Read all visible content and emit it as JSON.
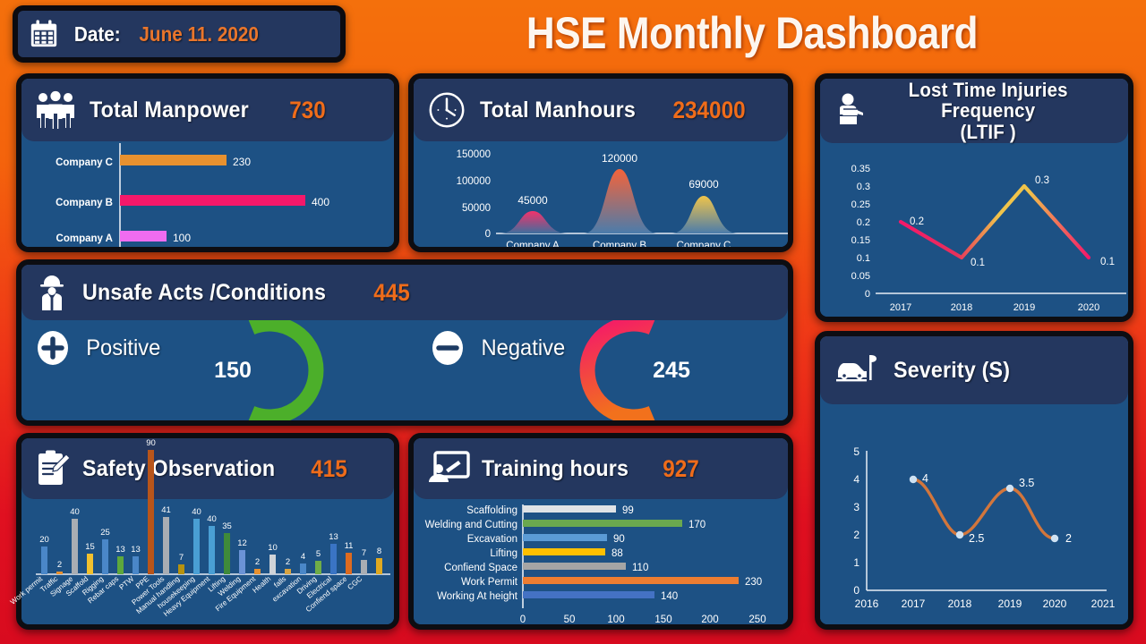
{
  "header": {
    "date_label": "Date:",
    "date_value": "June 11. 2020",
    "calendar_icon": "calendar-icon",
    "title": "HSE Monthly Dashboard"
  },
  "theme": {
    "bg_top": "#f4700c",
    "bg_bottom": "#d80b1f",
    "card_bg": "#1d5184",
    "header_bg": "#24375f",
    "accent_orange": "#ef6c1a",
    "text_white": "#ffffff"
  },
  "panels": {
    "manpower": {
      "icon": "people-group-icon",
      "title": "Total Manpower",
      "total": "730"
    },
    "manhours": {
      "icon": "clock-icon",
      "title": "Total Manhours",
      "total": "234000"
    },
    "ltif": {
      "icon": "injured-person-icon",
      "title": "Lost Time Injuries Frequency\n(LTIF )"
    },
    "unsafe": {
      "icon": "worker-helmet-icon",
      "title": "Unsafe Acts /Conditions",
      "total": "445",
      "positive": {
        "icon": "plus-circle-icon",
        "label": "Positive",
        "value": "150",
        "color": "#4caf2a"
      },
      "negative": {
        "icon": "minus-circle-icon",
        "label": "Negative",
        "value": "245",
        "color_start": "#f4186a",
        "color_end": "#f2711c"
      }
    },
    "observation": {
      "icon": "clipboard-pencil-icon",
      "title": "Safety Observation",
      "total": "415"
    },
    "training": {
      "icon": "presentation-person-icon",
      "title": "Training hours",
      "total": "927"
    },
    "severity": {
      "icon": "car-accident-icon",
      "title": "Severity (S)"
    }
  },
  "chart_data": [
    {
      "id": "manpower-chart",
      "type": "bar",
      "orientation": "horizontal",
      "title": "Total Manpower",
      "categories": [
        "Company C",
        "Company B",
        "Company A"
      ],
      "values": [
        230,
        400,
        100
      ],
      "colors": [
        "#e8912f",
        "#f4186a",
        "#f06cf0"
      ],
      "xlim": [
        0,
        470
      ],
      "grid": false,
      "axis": "vertical-line-only"
    },
    {
      "id": "manhours-chart",
      "type": "area",
      "shape": "bell-curve",
      "title": "Total Manhours",
      "categories": [
        "Company A",
        "Company B",
        "Company C"
      ],
      "values": [
        45000,
        120000,
        69000
      ],
      "yticks": [
        0,
        50000,
        100000,
        150000
      ],
      "ylim": [
        0,
        150000
      ],
      "colors": [
        "#f4326b",
        "#f4633a",
        "#f0c44a"
      ],
      "grid": false
    },
    {
      "id": "ltif-chart",
      "type": "line",
      "title": "Lost Time Injuries Frequency (LTIF )",
      "x": [
        "2017",
        "2018",
        "2019",
        "2020"
      ],
      "values": [
        0.2,
        0.1,
        0.3,
        0.1
      ],
      "labels": [
        "0.2",
        "0.1",
        "0.3",
        "0.1"
      ],
      "yticks": [
        "0",
        "0.05",
        "0.1",
        "0.15",
        "0.2",
        "0.25",
        "0.3",
        "0.35"
      ],
      "ylim": [
        0,
        0.35
      ],
      "line_gradient": [
        "#f4186a",
        "#f0c44a"
      ],
      "grid": false
    },
    {
      "id": "unsafe-positive-gauge",
      "type": "pie",
      "subtype": "donut-arc",
      "label": "Positive",
      "value": 150,
      "total": 445,
      "display": "150",
      "color": "#4caf2a"
    },
    {
      "id": "unsafe-negative-gauge",
      "type": "pie",
      "subtype": "donut-arc",
      "label": "Negative",
      "value": 245,
      "total": 445,
      "display": "245",
      "color_start": "#f4186a",
      "color_end": "#f2711c"
    },
    {
      "id": "observation-chart",
      "type": "bar",
      "orientation": "vertical",
      "title": "Safety Observation",
      "categories": [
        "Work permit",
        "Traffic",
        "Signage",
        "Scaffold",
        "Rigging",
        "Rebar caps",
        "PTW",
        "PPE",
        "Power Tools",
        "Manual handling",
        "housekeeping",
        "Heavy Equipment",
        "Lifting",
        "Welding",
        "Fire Equipment",
        "Health",
        "falls",
        "excavation",
        "Driving",
        "Electrical",
        "Confiend space",
        "CGC"
      ],
      "values": [
        20,
        2,
        40,
        15,
        25,
        13,
        13,
        90,
        41,
        7,
        40,
        40,
        35,
        12,
        2,
        10,
        2,
        4,
        5,
        13,
        11,
        7,
        8
      ],
      "ylim": [
        0,
        90
      ],
      "grid": false
    },
    {
      "id": "training-chart",
      "type": "bar",
      "orientation": "horizontal",
      "title": "Training hours",
      "categories": [
        "Scaffolding",
        "Welding and Cutting",
        "Excavation",
        "Lifting",
        "Confiend Space",
        "Work Permit",
        "Working At height"
      ],
      "values": [
        99,
        170,
        90,
        88,
        110,
        230,
        140
      ],
      "colors": [
        "#dfe3e6",
        "#6aa84f",
        "#5b9bd5",
        "#ffc000",
        "#a5a5a5",
        "#ed7d31",
        "#4472c4"
      ],
      "xticks": [
        "0",
        "50",
        "100",
        "150",
        "200",
        "250"
      ],
      "xlim": [
        0,
        250
      ],
      "grid": false
    },
    {
      "id": "severity-chart",
      "type": "line",
      "smooth": true,
      "title": "Severity (S)",
      "x": [
        "2016",
        "2017",
        "2018",
        "2019",
        "2020",
        "2021"
      ],
      "point_x": [
        "2017",
        "2018",
        "2019",
        "2020"
      ],
      "values": [
        4,
        2.5,
        3.5,
        2
      ],
      "labels": [
        "4",
        "2.5",
        "3.5",
        "2"
      ],
      "yticks": [
        "0",
        "1",
        "2",
        "3",
        "4",
        "5"
      ],
      "ylim": [
        0,
        5
      ],
      "line_color": "#d2763c",
      "marker_color": "#cfe2f3",
      "grid": false
    }
  ]
}
